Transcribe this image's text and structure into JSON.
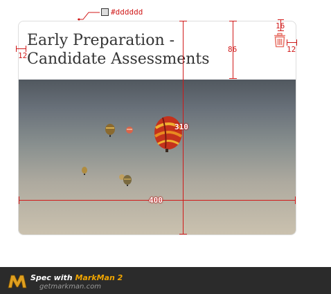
{
  "card": {
    "title": "Early Preparation - Candidate Assessments",
    "delete_icon": "trash-icon",
    "image_alt": "hot-air-balloons-photo"
  },
  "annotations": {
    "border_color": "#dddddd",
    "left_padding": "12",
    "right_padding": "12",
    "top_offset": "16",
    "header_height": "86",
    "card_height": "310",
    "card_width": "400"
  },
  "footer": {
    "brand_prefix": "Spec with ",
    "brand_name": "MarkMan 2",
    "url": "getmarkman.com"
  },
  "colors": {
    "annotation": "#d01818",
    "brand_accent": "#f0a500"
  }
}
